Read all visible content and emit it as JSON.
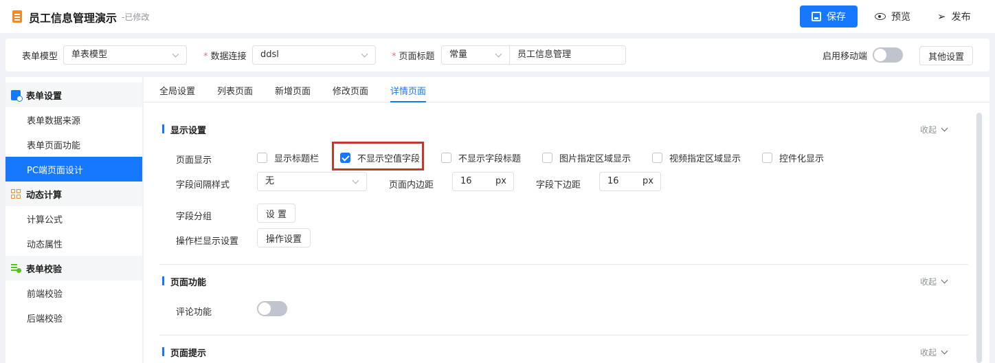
{
  "header": {
    "title": "员工信息管理演示",
    "status": "-已修改",
    "save_label": "保存",
    "preview_label": "预览",
    "publish_label": "发布"
  },
  "topbar": {
    "form_model_label": "表单模型",
    "form_model_value": "单表模型",
    "data_conn_label": "数据连接",
    "data_conn_value": "ddsl",
    "page_title_label": "页面标题",
    "page_title_mode": "常量",
    "page_title_value": "员工信息管理",
    "mobile_label": "启用移动端",
    "mobile_enabled": false,
    "other_settings_label": "其他设置"
  },
  "sidebar": {
    "groups": [
      {
        "label": "表单设置",
        "icon": "form-settings-icon",
        "items": [
          "表单数据来源",
          "表单页面功能",
          "PC端页面设计"
        ]
      },
      {
        "label": "动态计算",
        "icon": "calc-icon",
        "items": [
          "计算公式",
          "动态属性"
        ]
      },
      {
        "label": "表单校验",
        "icon": "validate-icon",
        "items": [
          "前端校验",
          "后端校验"
        ]
      }
    ],
    "active_item": "PC端页面设计"
  },
  "tabs": [
    "全局设置",
    "列表页面",
    "新增页面",
    "修改页面",
    "详情页面"
  ],
  "active_tab": "详情页面",
  "display_section": {
    "title": "显示设置",
    "collapse_label": "收起",
    "page_display_label": "页面显示",
    "options": [
      {
        "label": "显示标题栏",
        "checked": false
      },
      {
        "label": "不显示空值字段",
        "checked": true
      },
      {
        "label": "不显示字段标题",
        "checked": false
      },
      {
        "label": "图片指定区域显示",
        "checked": false
      },
      {
        "label": "视频指定区域显示",
        "checked": false
      },
      {
        "label": "控件化显示",
        "checked": false
      }
    ],
    "field_spacing_label": "字段间隔样式",
    "field_spacing_value": "无",
    "page_padding_label": "页面内边距",
    "page_padding_value": "16",
    "page_padding_unit": "px",
    "field_bottom_label": "字段下边距",
    "field_bottom_value": "16",
    "field_bottom_unit": "px",
    "field_group_label": "字段分组",
    "field_group_button": "设 置",
    "action_bar_label": "操作栏显示设置",
    "action_bar_button": "操作设置"
  },
  "function_section": {
    "title": "页面功能",
    "collapse_label": "收起",
    "comment_label": "评论功能",
    "comment_enabled": false
  },
  "tip_section": {
    "title": "页面提示",
    "collapse_label": "收起"
  },
  "colors": {
    "accent": "#1677ff",
    "highlight": "#c0392b",
    "doc_icon": "#f08a24"
  }
}
